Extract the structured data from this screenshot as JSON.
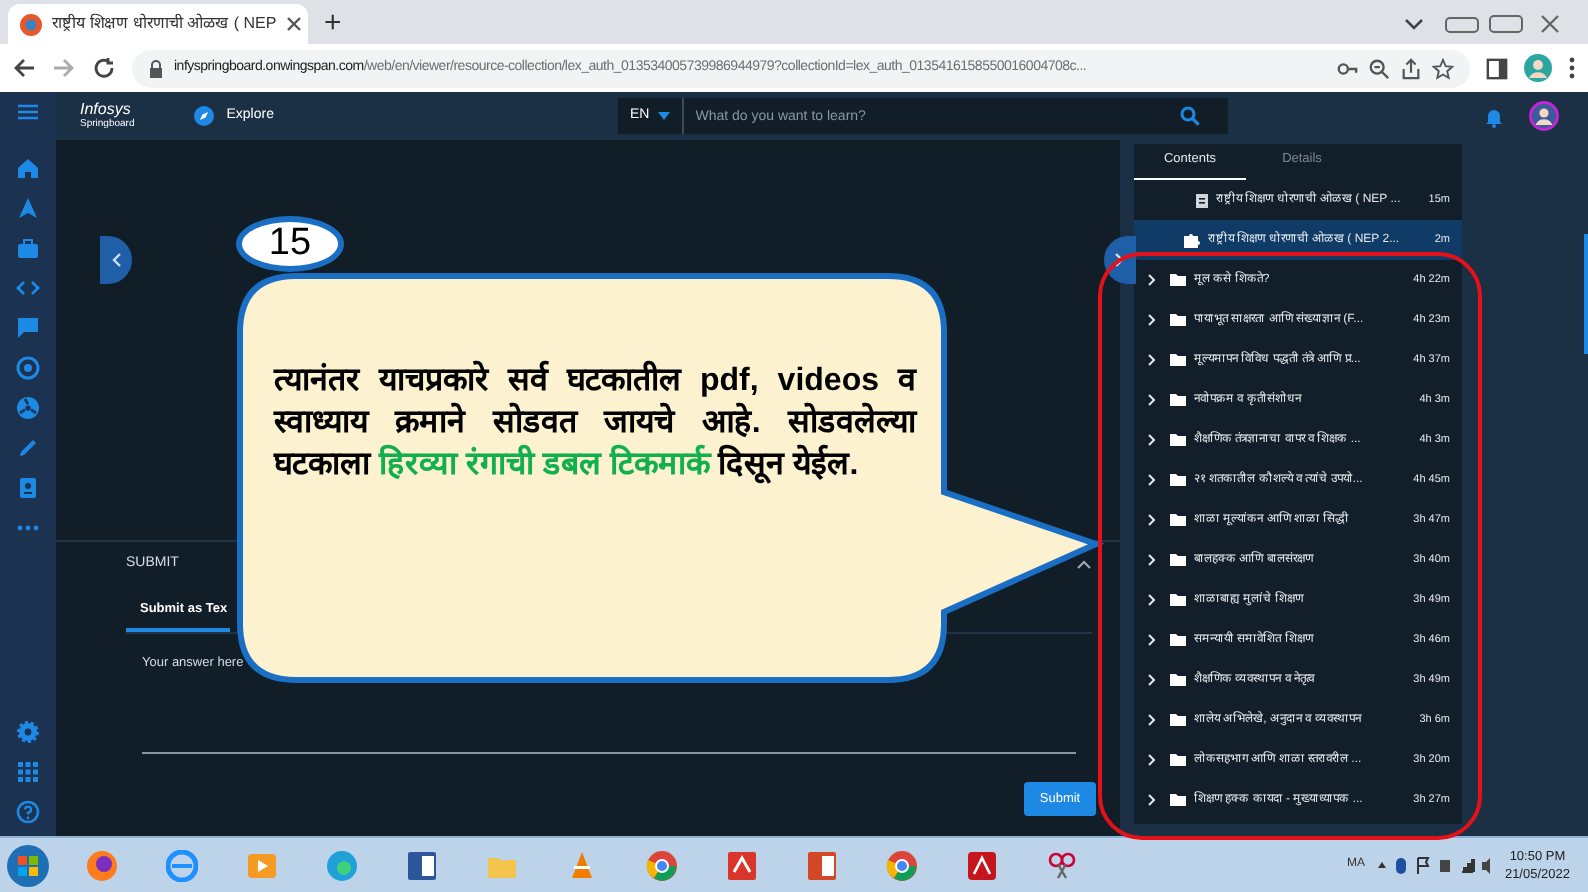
{
  "browser": {
    "tab_title": "राष्ट्रीय शिक्षण धोरणाची ओळख ( NEP",
    "new_tab": "+",
    "url_host": "infyspringboard.onwingspan.com",
    "url_path": "/web/en/viewer/resource-collection/lex_auth_013534005739986944979?collectionId=lex_auth_0135416158550016004708c..."
  },
  "header": {
    "logo_line_1": "Infosys",
    "logo_line_2": "Springboard",
    "explore": "Explore",
    "language": "EN",
    "search_placeholder": "What do you want to learn?"
  },
  "contents_panel": {
    "tabs": [
      {
        "label": "Contents",
        "selected": true
      },
      {
        "label": "Details",
        "selected": false
      }
    ],
    "items": [
      {
        "kind": "document",
        "title": "राष्ट्रीय शिक्षण धोरणाची ओळख ( NEP ...",
        "duration": "15m",
        "selected": false
      },
      {
        "kind": "puzzle",
        "title": "राष्ट्रीय शिक्षण धोरणाची ओळख ( NEP 2...",
        "duration": "2m",
        "selected": true
      },
      {
        "kind": "folder",
        "title": "मूल कसे शिकते?",
        "duration": "4h 22m",
        "selected": false
      },
      {
        "kind": "folder",
        "title": "पायाभूत साक्षरता आणि संख्याज्ञान (F...",
        "duration": "4h 23m",
        "selected": false
      },
      {
        "kind": "folder",
        "title": "मूल्यमापन विविध पद्धती तंत्रे आणि प्र...",
        "duration": "4h 37m",
        "selected": false
      },
      {
        "kind": "folder",
        "title": "नवोपक्रम व कृतीसंशोधन",
        "duration": "4h 3m",
        "selected": false
      },
      {
        "kind": "folder",
        "title": "शैक्षणिक तंत्रज्ञानाचा वापर व शिक्षक ...",
        "duration": "4h 3m",
        "selected": false
      },
      {
        "kind": "folder",
        "title": "२१ शतकातील कौशल्ये व त्यांचे उपयो...",
        "duration": "4h 45m",
        "selected": false
      },
      {
        "kind": "folder",
        "title": "शाळा मूल्यांकन आणि शाळा सिद्धी",
        "duration": "3h 47m",
        "selected": false
      },
      {
        "kind": "folder",
        "title": "बालहक्क आणि बालसंरक्षण",
        "duration": "3h 40m",
        "selected": false
      },
      {
        "kind": "folder",
        "title": "शाळाबाह्य मुलांचे शिक्षण",
        "duration": "3h 49m",
        "selected": false
      },
      {
        "kind": "folder",
        "title": "समन्यायी समावेशित शिक्षण",
        "duration": "3h 46m",
        "selected": false
      },
      {
        "kind": "folder",
        "title": "शैक्षणिक व्यवस्थापन व नेतृत्व",
        "duration": "3h 49m",
        "selected": false
      },
      {
        "kind": "folder",
        "title": "शालेय अभिलेखे, अनुदान व व्यवस्थापन",
        "duration": "3h 6m",
        "selected": false
      },
      {
        "kind": "folder",
        "title": "लोकसहभाग आणि शाळा स्तरावरील ...",
        "duration": "3h 20m",
        "selected": false
      },
      {
        "kind": "folder",
        "title": "शिक्षण हक्क कायदा - मुख्याध्यापक ...",
        "duration": "3h 27m",
        "selected": false
      }
    ]
  },
  "submit": {
    "heading": "SUBMIT",
    "tabs": [
      {
        "label": "Submit as Tex",
        "selected": true
      }
    ],
    "placeholder": "Your answer here",
    "button": "Submit"
  },
  "callout": {
    "number": "15",
    "parts": [
      {
        "text": "त्यानंतर याचप्रकारे सर्व घटकातील pdf, videos व स्वाध्याय क्रमाने सोडवत जायचे आहे. सोडवलेल्या घटकाला ",
        "highlight": false
      },
      {
        "text": "हिरव्या रंगाची डबल टिकमार्क",
        "highlight": true
      },
      {
        "text": " दिसून येईल.",
        "highlight": false
      }
    ]
  },
  "taskbar": {
    "language": "MA",
    "time": "10:50 PM",
    "date": "21/05/2022"
  }
}
